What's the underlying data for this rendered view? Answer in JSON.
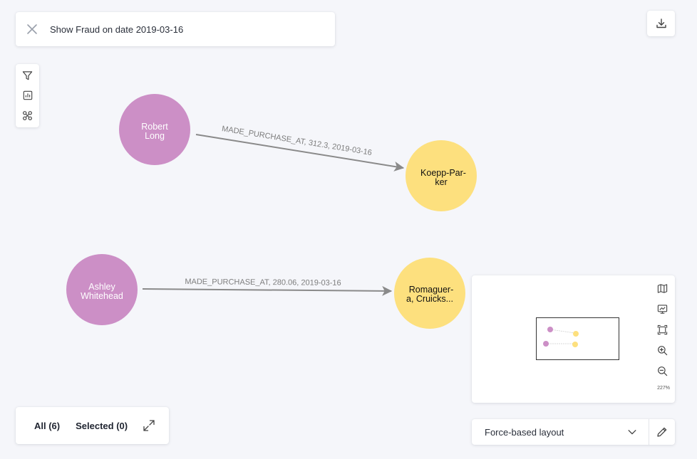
{
  "query": {
    "text": "Show Fraud on date 2019-03-16"
  },
  "graph": {
    "nodes": [
      {
        "line1": "Robert",
        "line2": "Long",
        "type": "person",
        "color": "#cc8fc6",
        "text_color": "#ffffff"
      },
      {
        "line1": "Koepp-Par-",
        "line2": "ker",
        "type": "merchant",
        "color": "#fde07e",
        "text_color": "#111111"
      },
      {
        "line1": "Ashley",
        "line2": "Whitehead",
        "type": "person",
        "color": "#cc8fc6",
        "text_color": "#ffffff"
      },
      {
        "line1": "Romaguer-",
        "line2": "a, Cruicks...",
        "type": "merchant",
        "color": "#fde07e",
        "text_color": "#111111"
      }
    ],
    "edges": [
      {
        "label": "MADE_PURCHASE_AT, 312.3, 2019-03-16",
        "from": "Robert Long",
        "to": "Koepp-Parker"
      },
      {
        "label": "MADE_PURCHASE_AT, 280.06, 2019-03-16",
        "from": "Ashley Whitehead",
        "to": "Romaguera, Cruickshank"
      }
    ],
    "edge_color": "#8a8a8a"
  },
  "left_tools": [
    {
      "icon": "filter-icon"
    },
    {
      "icon": "chart-icon"
    },
    {
      "icon": "algorithm-icon"
    }
  ],
  "map_tools": [
    {
      "icon": "map-icon"
    },
    {
      "icon": "presentation-icon"
    },
    {
      "icon": "fit-screen-icon"
    },
    {
      "icon": "zoom-in-icon"
    },
    {
      "icon": "zoom-out-icon"
    }
  ],
  "zoom_level": "227%",
  "layout": {
    "selected": "Force-based layout"
  },
  "selection": {
    "all_label": "All (6)",
    "selected_label": "Selected (0)"
  }
}
